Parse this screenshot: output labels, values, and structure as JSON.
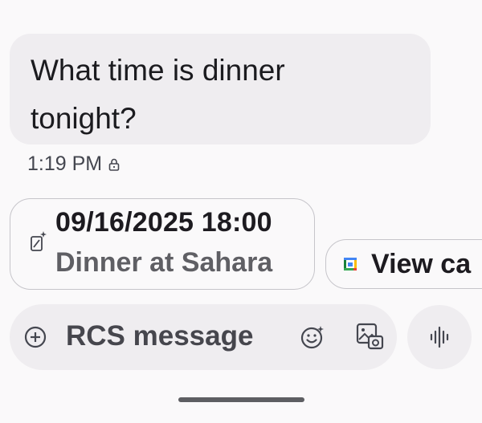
{
  "message": {
    "lines": [
      "What time is dinner",
      "tonight?"
    ],
    "time": "1:19 PM"
  },
  "suggestions": {
    "event": {
      "datetime": "09/16/2025 18:00",
      "title": "Dinner at Sahara",
      "icon": "calendar-add-icon"
    },
    "calendar": {
      "label": "View ca",
      "icon": "google-calendar-icon"
    }
  },
  "composer": {
    "placeholder": "RCS message",
    "icons": [
      "add-circle-icon",
      "emoji-icon",
      "gallery-icon",
      "voice-icon"
    ]
  },
  "colors": {
    "background": "#faf9fa",
    "bubble": "#efedf0",
    "chip_border": "#c6c5ca",
    "text": "#1c1b1f",
    "muted_text": "#5f5f64"
  }
}
